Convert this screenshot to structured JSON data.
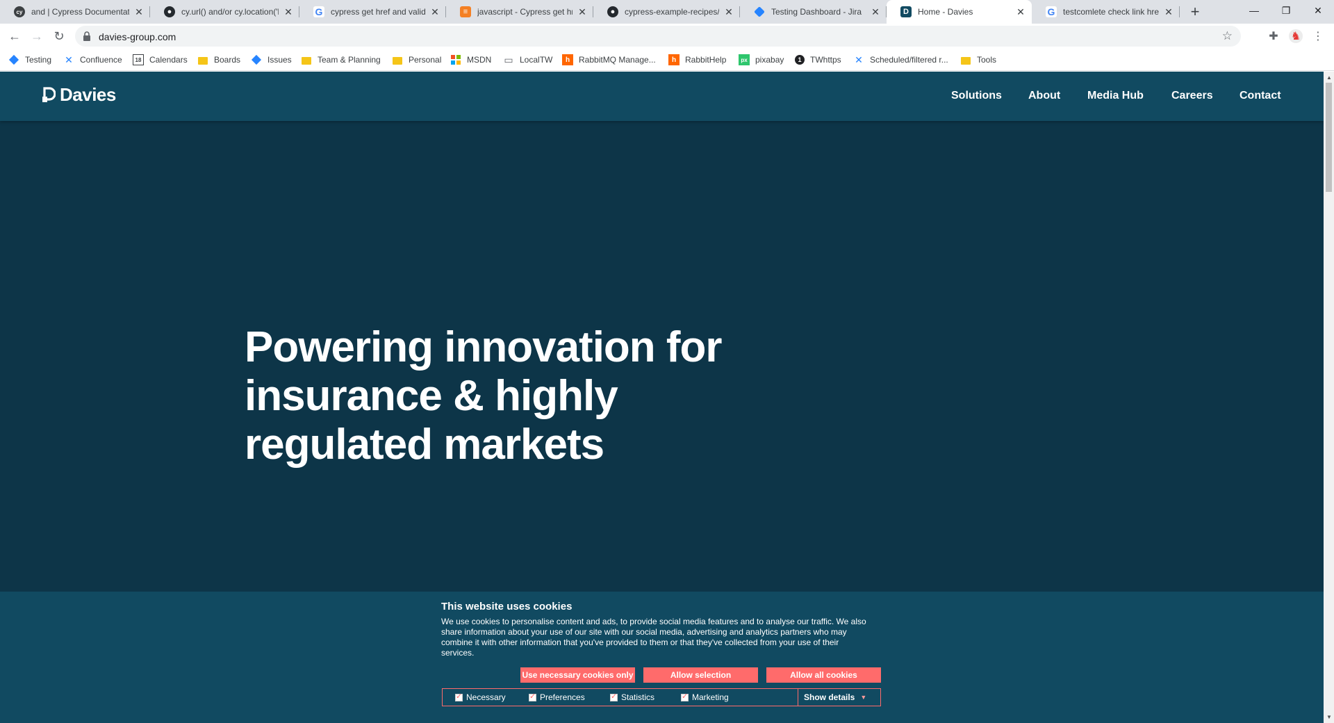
{
  "browser": {
    "tabs": [
      {
        "title": "and | Cypress Documentation",
        "icon": "cypress-icon",
        "active": false
      },
      {
        "title": "cy.url() and/or cy.location('h",
        "icon": "github-icon",
        "active": false
      },
      {
        "title": "cypress get href and validate",
        "icon": "google-icon",
        "active": false
      },
      {
        "title": "javascript - Cypress get href",
        "icon": "stackoverflow-icon",
        "active": false
      },
      {
        "title": "cypress-example-recipes/ta",
        "icon": "github-icon",
        "active": false
      },
      {
        "title": "Testing Dashboard - Jira",
        "icon": "jira-icon",
        "active": false
      },
      {
        "title": "Home - Davies",
        "icon": "davies-icon",
        "active": true
      },
      {
        "title": "testcomlete check link href",
        "icon": "google-icon",
        "active": false
      }
    ],
    "url": "davies-group.com",
    "bookmarks": [
      {
        "label": "Testing",
        "icon": "jira-icon"
      },
      {
        "label": "Confluence",
        "icon": "confluence-icon"
      },
      {
        "label": "Calendars",
        "icon": "calendar-icon"
      },
      {
        "label": "Boards",
        "icon": "folder-icon"
      },
      {
        "label": "Issues",
        "icon": "jira-icon"
      },
      {
        "label": "Team & Planning",
        "icon": "folder-icon"
      },
      {
        "label": "Personal",
        "icon": "folder-icon"
      },
      {
        "label": "MSDN",
        "icon": "microsoft-icon"
      },
      {
        "label": "LocalTW",
        "icon": "laptop-icon"
      },
      {
        "label": "RabbitMQ Manage...",
        "icon": "rabbitmq-icon"
      },
      {
        "label": "RabbitHelp",
        "icon": "rabbitmq-icon"
      },
      {
        "label": "pixabay",
        "icon": "pixabay-icon"
      },
      {
        "label": "TWhttps",
        "icon": "circle-one-icon"
      },
      {
        "label": "Scheduled/filtered r...",
        "icon": "confluence-icon"
      },
      {
        "label": "Tools",
        "icon": "folder-icon"
      }
    ]
  },
  "site": {
    "logo": "Davies",
    "nav": [
      "Solutions",
      "About",
      "Media Hub",
      "Careers",
      "Contact"
    ],
    "hero": {
      "lines": [
        "Powering innovation for",
        "insurance & highly",
        "regulated markets"
      ]
    }
  },
  "cookies": {
    "title": "This website uses cookies",
    "text": "We use cookies to personalise content and ads, to provide social media features and to analyse our traffic. We also share information about your use of our site with our social media, advertising and analytics partners who may combine it with other information that you've provided to them or that they've collected from your use of their services.",
    "buttons": {
      "necessary": "Use necessary cookies only",
      "selection": "Allow selection",
      "all": "Allow all cookies"
    },
    "checkboxes": [
      "Necessary",
      "Preferences",
      "Statistics",
      "Marketing"
    ],
    "show_details": "Show details"
  },
  "colors": {
    "hero_bg": "#0d3548",
    "header_bg": "#114a61",
    "accent": "#ff6b6b"
  }
}
